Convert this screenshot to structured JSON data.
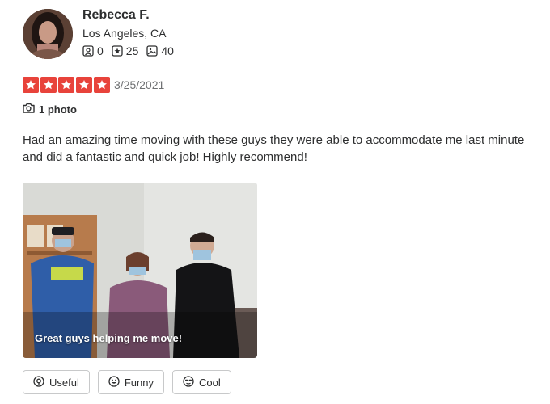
{
  "user": {
    "name": "Rebecca F.",
    "location": "Los Angeles, CA",
    "friends_count": "0",
    "reviews_count": "25",
    "photos_count": "40"
  },
  "review": {
    "rating_stars": 5,
    "date": "3/25/2021",
    "photo_label": "1 photo",
    "text": "Had an amazing time moving with these guys they were able to accommodate me last minute and did a fantastic and quick job! Highly recommend!",
    "photo_caption": "Great guys helping me move!"
  },
  "reactions": {
    "useful": "Useful",
    "funny": "Funny",
    "cool": "Cool"
  },
  "colors": {
    "star": "#e8433b",
    "text": "#2d2e2f",
    "muted": "#6e7072"
  },
  "icons": [
    "friends-icon",
    "reviews-icon",
    "photos-icon",
    "star-icon",
    "camera-icon",
    "useful-icon",
    "funny-icon",
    "cool-icon"
  ]
}
